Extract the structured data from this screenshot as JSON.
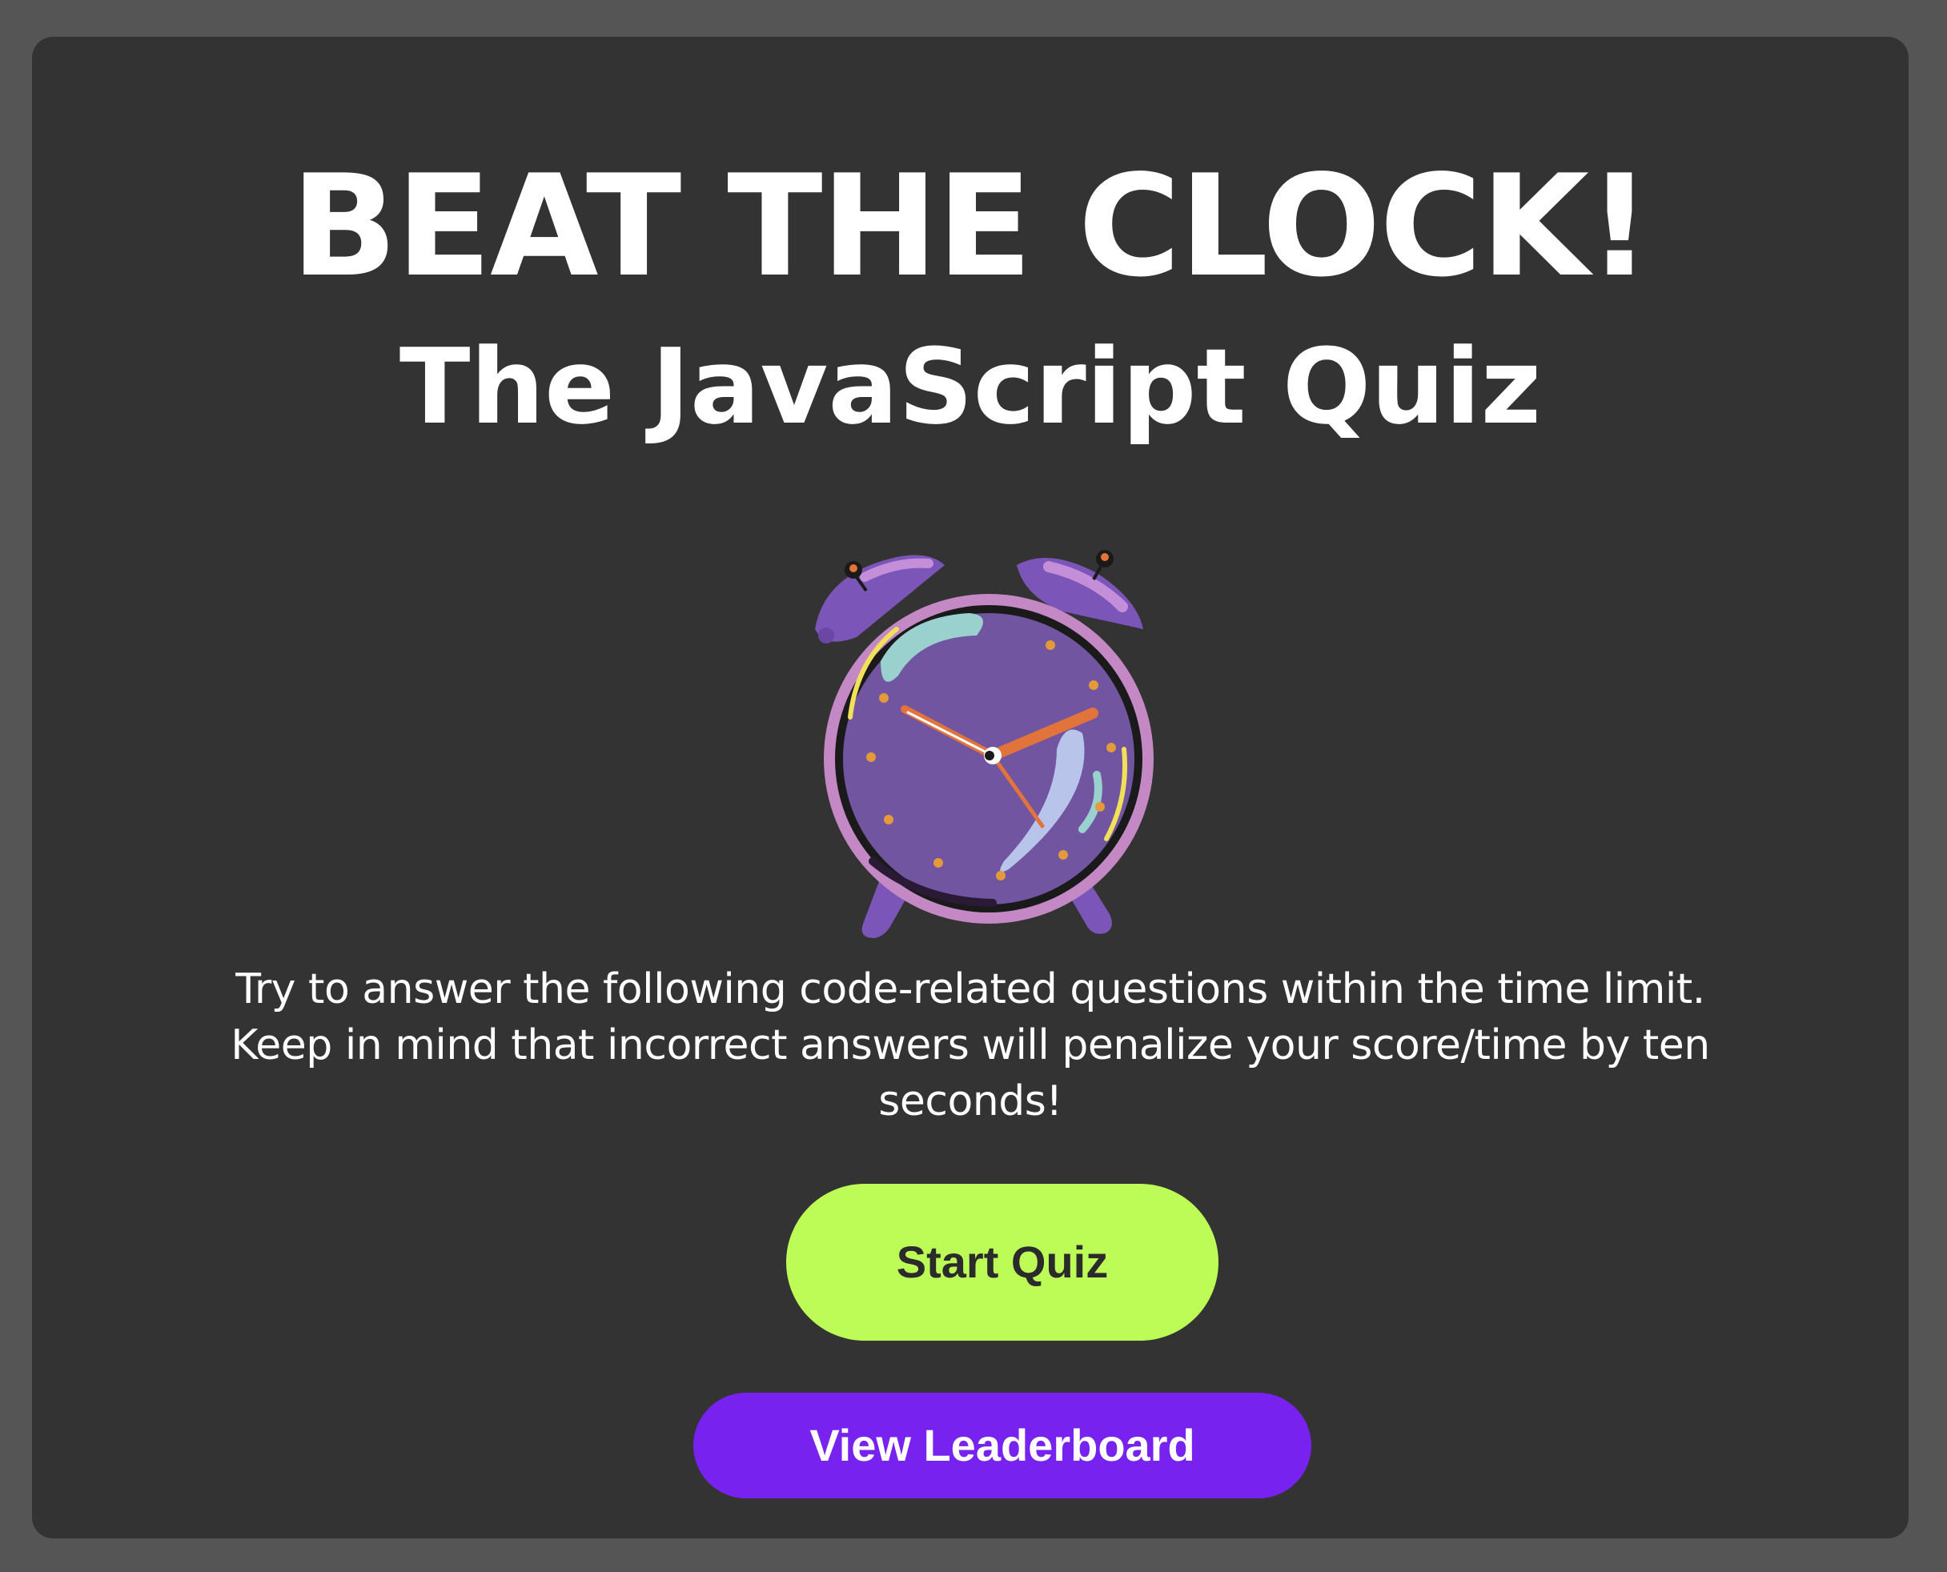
{
  "header": {
    "title": "BEAT THE CLOCK!",
    "subtitle": "The JavaScript Quiz"
  },
  "illustration": {
    "icon": "alarm-clock-icon",
    "colors": {
      "body": "#7155a0",
      "rim": "#c488c4",
      "hands": "#e2733a",
      "highlight": "#9ad0cd"
    }
  },
  "description": "Try to answer the following code-related questions within the time limit. Keep in mind that incorrect answers will penalize your score/time by ten seconds!",
  "buttons": {
    "start_label": "Start Quiz",
    "leaderboard_label": "View Leaderboard"
  },
  "colors": {
    "page_background": "#555555",
    "card_background": "#333333",
    "start_button": "#bdfc57",
    "leaderboard_button": "#7722ee"
  }
}
